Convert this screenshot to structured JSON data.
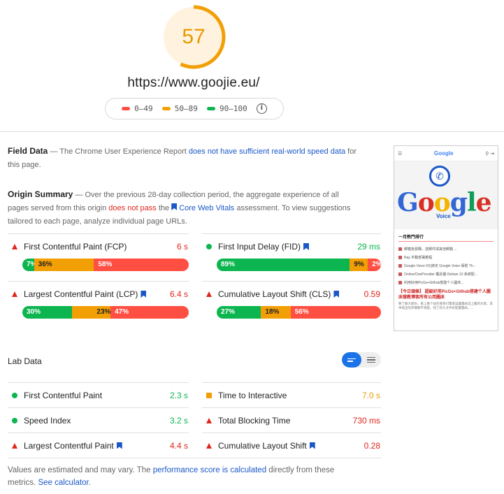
{
  "score": {
    "value": "57",
    "fraction": 0.57,
    "color": "#f29f05",
    "bg": "#fff3e0"
  },
  "url": "https://www.goojie.eu/",
  "legend": {
    "ranges": [
      {
        "label": "0–49",
        "color": "#ff4f43"
      },
      {
        "label": "50–89",
        "color": "#f29f05"
      },
      {
        "label": "90–100",
        "color": "#0cb54f"
      }
    ],
    "info_icon": "i"
  },
  "field_data": {
    "title": "Field Data",
    "text1": " — The Chrome User Experience Report ",
    "link": "does not have sufficient real-world speed data",
    "text2": " for this page."
  },
  "origin_summary": {
    "title": "Origin Summary",
    "text1": " — Over the previous 28-day collection period, the aggregate experience of all pages served from this origin ",
    "fail": "does not pass",
    "text2": " the ",
    "link": "Core Web Vitals",
    "text3": " assessment. To view suggestions tailored to each page, analyze individual page URLs."
  },
  "origin_metrics": [
    {
      "name": "First Contentful Paint (FCP)",
      "value": "6 s",
      "status": "poor",
      "badge": false,
      "dist": [
        {
          "pct": "7%",
          "w": 7
        },
        {
          "pct": "36%",
          "w": 36
        },
        {
          "pct": "58%",
          "w": 58
        }
      ]
    },
    {
      "name": "First Input Delay (FID)",
      "value": "29 ms",
      "status": "good",
      "badge": true,
      "dist": [
        {
          "pct": "89%",
          "w": 89
        },
        {
          "pct": "9%",
          "w": 9
        },
        {
          "pct": "2%",
          "w": 2
        }
      ]
    },
    {
      "name": "Largest Contentful Paint (LCP)",
      "value": "6.4 s",
      "status": "poor",
      "badge": true,
      "dist": [
        {
          "pct": "30%",
          "w": 30
        },
        {
          "pct": "23%",
          "w": 23
        },
        {
          "pct": "47%",
          "w": 47
        }
      ]
    },
    {
      "name": "Cumulative Layout Shift (CLS)",
      "value": "0.59",
      "status": "poor",
      "badge": true,
      "dist": [
        {
          "pct": "27%",
          "w": 27
        },
        {
          "pct": "18%",
          "w": 18
        },
        {
          "pct": "56%",
          "w": 56
        }
      ]
    }
  ],
  "lab_data": {
    "title": "Lab Data",
    "metrics": [
      {
        "name": "First Contentful Paint",
        "value": "2.3 s",
        "status": "good",
        "badge": false
      },
      {
        "name": "Time to Interactive",
        "value": "7.0 s",
        "status": "average",
        "badge": false
      },
      {
        "name": "Speed Index",
        "value": "3.2 s",
        "status": "good",
        "badge": false
      },
      {
        "name": "Total Blocking Time",
        "value": "730 ms",
        "status": "poor",
        "badge": false
      },
      {
        "name": "Largest Contentful Paint",
        "value": "4.4 s",
        "status": "poor",
        "badge": true
      },
      {
        "name": "Cumulative Layout Shift",
        "value": "0.28",
        "status": "poor",
        "badge": true
      }
    ]
  },
  "footer": {
    "text1": "Values are estimated and may vary. The ",
    "link1": "performance score is calculated",
    "text2": " directly from these metrics. ",
    "link2": "See calculator",
    "text3": "."
  },
  "colors": {
    "good": "#0cb54f",
    "average": "#e89a00",
    "poor": "#e0261c",
    "link": "#1a57c9"
  },
  "thumbnail": {
    "logo": "Google",
    "hero_brand": "Google",
    "hero_sub": "Voice",
    "section_title": "一月熱門排行",
    "items": [
      "郵箱批發購，送郵件與其他郵箱 ...",
      "Ray 手動部署教程",
      "Google Voice 0元綁定 Google Voice 保號 Th...",
      "Online/OneProvider 獨具優 Debian 10 系統配...",
      "利用好用PicGo+Github搭建个人圖床..."
    ],
    "article_title": "【今日頭條】 超級好用PicGo+Github搭建个人圖床搜教博客所有公用圖床",
    "article_text": "要了解大部份，來上幾个站在搜尋引擎來設置圖床這上載的文章，其中寫出的步驟都不清楚，找了好久才弄好配置圖床。..."
  }
}
